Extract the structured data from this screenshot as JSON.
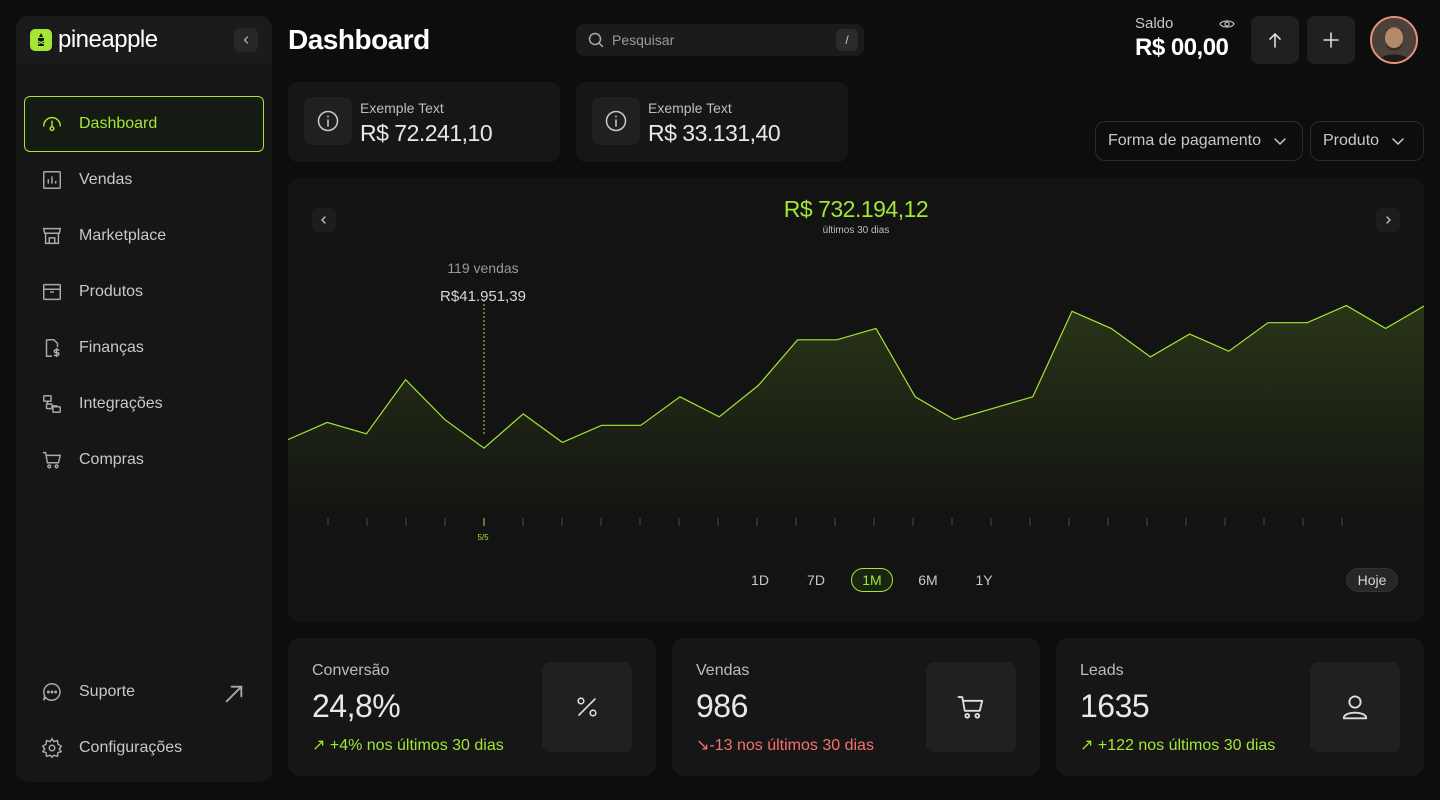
{
  "app": {
    "name": "pineapple"
  },
  "sidebar": {
    "items": [
      {
        "label": "Dashboard",
        "icon": "gauge-icon",
        "active": true
      },
      {
        "label": "Vendas",
        "icon": "bar-chart-icon"
      },
      {
        "label": "Marketplace",
        "icon": "storefront-icon"
      },
      {
        "label": "Produtos",
        "icon": "box-icon"
      },
      {
        "label": "Finanças",
        "icon": "finance-icon"
      },
      {
        "label": "Integrações",
        "icon": "integration-icon"
      },
      {
        "label": "Compras",
        "icon": "cart-icon"
      }
    ],
    "bottom": [
      {
        "label": "Suporte",
        "icon": "chat-icon"
      },
      {
        "label": "Configurações",
        "icon": "gear-icon"
      }
    ]
  },
  "header": {
    "title": "Dashboard",
    "search_placeholder": "Pesquisar",
    "search_shortcut": "/",
    "saldo_label": "Saldo",
    "saldo_value": "R$ 00,00"
  },
  "stats": [
    {
      "label": "Exemple Text",
      "value": "R$ 72.241,10"
    },
    {
      "label": "Exemple Text",
      "value": "R$ 33.131,40"
    }
  ],
  "filters": [
    {
      "label": "Forma de pagamento"
    },
    {
      "label": "Produto"
    }
  ],
  "chart": {
    "total": "R$ 732.194,12",
    "subtitle": "últimos 30 dias",
    "tooltip_count": "119 vendas",
    "tooltip_amount": "R$41.951,39",
    "selected_tick": "5/5",
    "ranges": [
      "1D",
      "7D",
      "1M",
      "6M",
      "1Y"
    ],
    "active_range": "1M",
    "today_label": "Hoje"
  },
  "chart_data": {
    "type": "area",
    "highlighted_index": 5,
    "values": [
      8.5,
      11.5,
      9.5,
      19,
      12,
      7,
      13,
      8,
      11,
      11,
      16,
      12.5,
      18,
      26,
      26,
      28,
      16,
      12,
      14,
      16,
      31,
      28,
      23,
      27,
      24,
      29,
      29,
      32,
      28,
      32
    ],
    "color": "#a3e635"
  },
  "kpis": [
    {
      "label": "Conversão",
      "value": "24,8%",
      "trend": "+4% nos últimos 30 dias",
      "direction": "up",
      "icon": "percent-icon"
    },
    {
      "label": "Vendas",
      "value": "986",
      "trend": "-13 nos últimos 30 dias",
      "direction": "down",
      "icon": "cart-icon"
    },
    {
      "label": "Leads",
      "value": "1635",
      "trend": "+122 nos últimos 30 dias",
      "direction": "up",
      "icon": "user-icon"
    }
  ],
  "colors": {
    "accent": "#a3e635",
    "negative": "#f87171",
    "background": "#0c0d0c",
    "card": "#151615"
  }
}
